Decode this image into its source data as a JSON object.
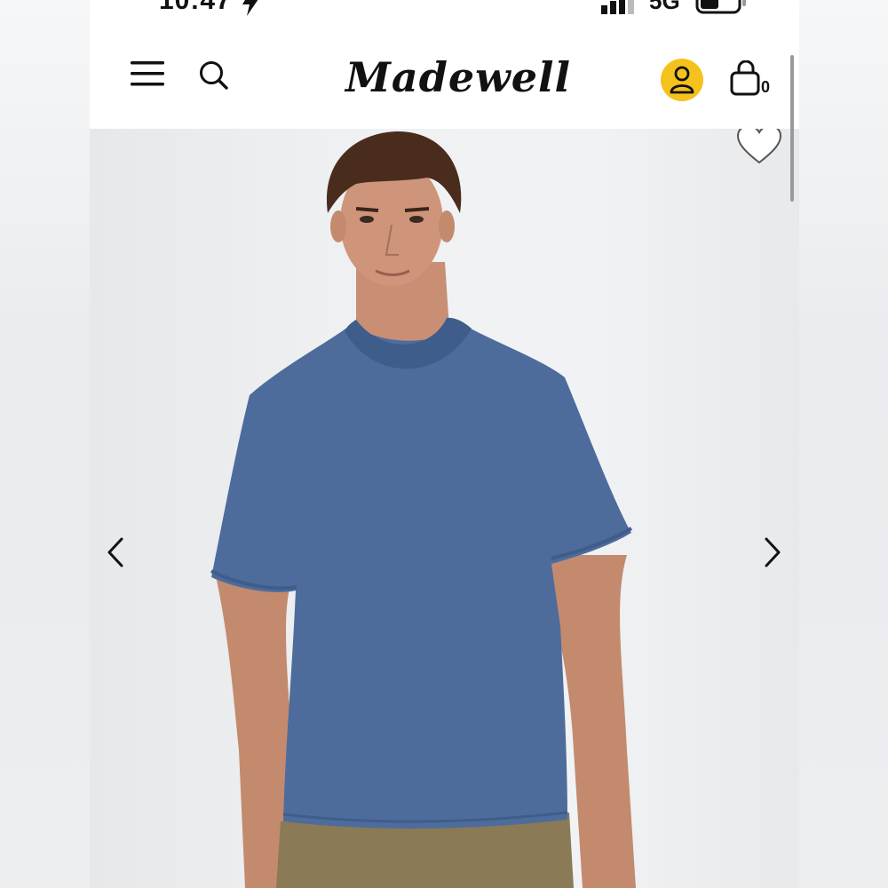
{
  "status_bar": {
    "time": "10:47",
    "network": "5G"
  },
  "header": {
    "brand": "Madewell",
    "bag_count": "0",
    "accent_color": "#f5c11c"
  },
  "icons": {
    "menu": "hamburger-menu-icon",
    "search": "search-icon",
    "account": "user-icon",
    "bag": "shopping-bag-icon",
    "wishlist": "heart-icon",
    "prev": "chevron-left-icon",
    "next": "chevron-right-icon"
  },
  "product": {
    "shirt_color": "#4d6c9c",
    "pants_color": "#8a7a55"
  }
}
